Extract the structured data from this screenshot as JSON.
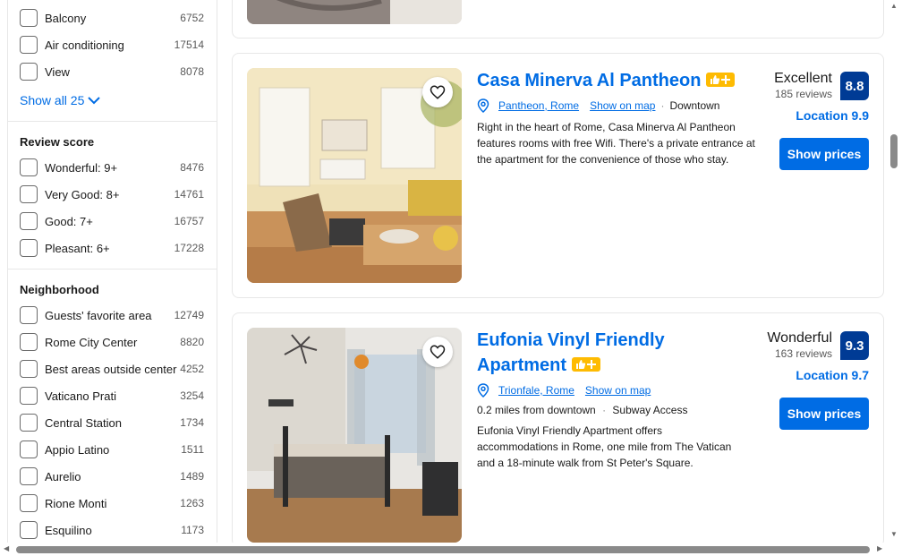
{
  "filters": {
    "facilities": [
      {
        "label": "Balcony",
        "count": "6752"
      },
      {
        "label": "Air conditioning",
        "count": "17514"
      },
      {
        "label": "View",
        "count": "8078"
      }
    ],
    "show_all": "Show all 25",
    "review_score": {
      "title": "Review score",
      "items": [
        {
          "label": "Wonderful: 9+",
          "count": "8476"
        },
        {
          "label": "Very Good: 8+",
          "count": "14761"
        },
        {
          "label": "Good: 7+",
          "count": "16757"
        },
        {
          "label": "Pleasant: 6+",
          "count": "17228"
        }
      ]
    },
    "neighborhood": {
      "title": "Neighborhood",
      "items": [
        {
          "label": "Guests' favorite area",
          "count": "12749"
        },
        {
          "label": "Rome City Center",
          "count": "8820"
        },
        {
          "label": "Best areas outside center",
          "count": "4252"
        },
        {
          "label": "Vaticano Prati",
          "count": "3254"
        },
        {
          "label": "Central Station",
          "count": "1734"
        },
        {
          "label": "Appio Latino",
          "count": "1511"
        },
        {
          "label": "Aurelio",
          "count": "1489"
        },
        {
          "label": "Rione Monti",
          "count": "1263"
        },
        {
          "label": "Esquilino",
          "count": "1173"
        }
      ]
    }
  },
  "listings": [
    {
      "title": "Casa Minerva Al Pantheon",
      "area": "Pantheon, Rome",
      "map_link": "Show on map",
      "tag": "Downtown",
      "description": "Right in the heart of Rome, Casa Minerva Al Pantheon features rooms with free Wifi. There's a private entrance at the apartment for the convenience of those who stay.",
      "rating_word": "Excellent",
      "reviews": "185 reviews",
      "score": "8.8",
      "location_score": "Location 9.9",
      "button": "Show prices"
    },
    {
      "title_line1": "Eufonia Vinyl Friendly",
      "title_line2": "Apartment",
      "area": "Trionfale, Rome",
      "map_link": "Show on map",
      "distance": "0.2 miles from downtown",
      "access": "Subway Access",
      "description": "Eufonia Vinyl Friendly Apartment offers accommodations in Rome, one mile from The Vatican and a 18-minute walk from St Peter's Square.",
      "rating_word": "Wonderful",
      "reviews": "163 reviews",
      "score": "9.3",
      "location_score": "Location 9.7",
      "button": "Show prices"
    }
  ],
  "colors": {
    "link": "#006ce4",
    "score_bg": "#003b95",
    "badge": "#febb02",
    "button": "#006ce4"
  },
  "icons": [
    "chevron-down-icon",
    "heart-icon",
    "map-pin-icon",
    "thumbs-up-icon",
    "plus-icon"
  ]
}
